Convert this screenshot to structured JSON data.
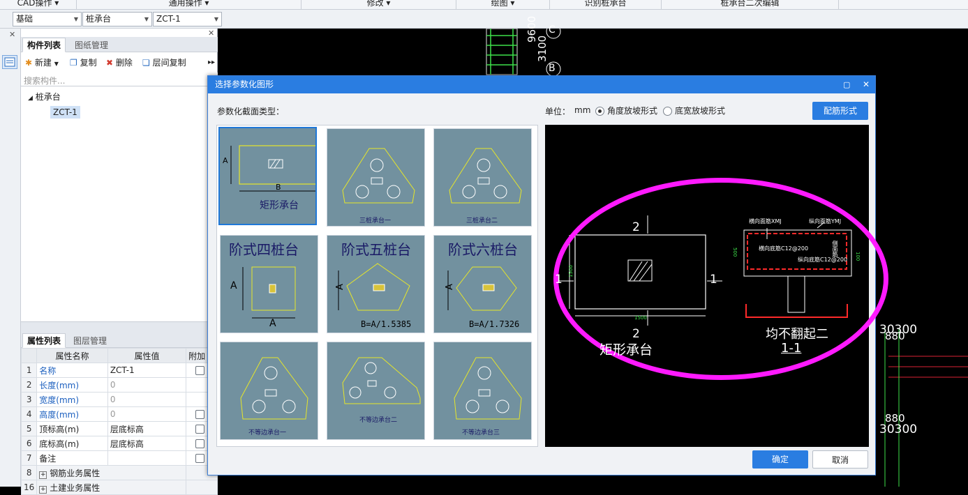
{
  "ribbon": {
    "groups": [
      "CAD操作 ▾",
      "通用操作 ▾",
      "修改 ▾",
      "绘图 ▾",
      "识别桩承台",
      "桩承台二次编辑"
    ]
  },
  "selectors": {
    "floor": "基础",
    "type": "桩承台",
    "component": "ZCT-1"
  },
  "component_panel": {
    "tabs": [
      "构件列表",
      "图纸管理"
    ],
    "toolbar": {
      "new": "新建",
      "copy": "复制",
      "delete": "删除",
      "floor_copy": "层间复制"
    },
    "search_placeholder": "搜索构件...",
    "tree": {
      "root": "桩承台",
      "child": "ZCT-1"
    }
  },
  "property_panel": {
    "tabs": [
      "属性列表",
      "图层管理"
    ],
    "headers": [
      "属性名称",
      "属性值",
      "附加"
    ],
    "rows": [
      {
        "n": "1",
        "name": "名称",
        "value": "ZCT-1"
      },
      {
        "n": "2",
        "name": "长度(mm)",
        "value": "0"
      },
      {
        "n": "3",
        "name": "宽度(mm)",
        "value": "0"
      },
      {
        "n": "4",
        "name": "高度(mm)",
        "value": "0"
      },
      {
        "n": "5",
        "name": "顶标高(m)",
        "value": "层底标高"
      },
      {
        "n": "6",
        "name": "底标高(m)",
        "value": "层底标高"
      },
      {
        "n": "7",
        "name": "备注",
        "value": ""
      },
      {
        "n": "8",
        "name": "钢筋业务属性",
        "value": ""
      },
      {
        "n": "16",
        "name": "土建业务属性",
        "value": ""
      }
    ]
  },
  "cad": {
    "labels": {
      "c": "C",
      "b": "B",
      "v1": "9600",
      "v2": "3100",
      "r1": "30300",
      "r2": "880",
      "r3": "880",
      "r4": "30300"
    }
  },
  "dialog": {
    "title": "选择参数化图形",
    "section_label": "参数化截面类型：",
    "unit_label": "单位：",
    "unit_value": "mm",
    "radio1": "角度放坡形式",
    "radio2": "底宽放坡形式",
    "rebar_button": "配筋形式",
    "ok": "确定",
    "cancel": "取消",
    "thumbs": [
      {
        "label": "矩形承台",
        "dims": [
          "A",
          "B"
        ]
      },
      {
        "label": "三桩承台一",
        "dims": []
      },
      {
        "label": "三桩承台二",
        "dims": []
      },
      {
        "label": "阶式四桩台",
        "dims": [
          "A",
          "A"
        ],
        "foot": ""
      },
      {
        "label": "阶式五桩台",
        "dims": [
          "A"
        ],
        "foot": "B=A/1.5385"
      },
      {
        "label": "阶式六桩台",
        "dims": [
          "A"
        ],
        "foot": "B=A/1.7326"
      },
      {
        "label": "不等边承台一",
        "dims": []
      },
      {
        "label": "不等边承台二",
        "dims": []
      },
      {
        "label": "不等边承台三",
        "dims": []
      }
    ],
    "preview": {
      "sec_top": "2",
      "sec_bottom": "2",
      "sec_left": "1",
      "sec_right": "1",
      "w_dim": "1500",
      "h_dim": "1500",
      "plan_title": "矩形承台",
      "sec_title": "均不翻起二",
      "sec_name": "1-1",
      "rebar1": "横向面筋XMJ",
      "rebar2": "纵向面筋YMJ",
      "rebar3": "横向底筋C12@200",
      "rebar4": "纵向底筋C12@200",
      "rebar5": "侧面筋",
      "dim_500": "500",
      "dim_100": "100"
    }
  }
}
